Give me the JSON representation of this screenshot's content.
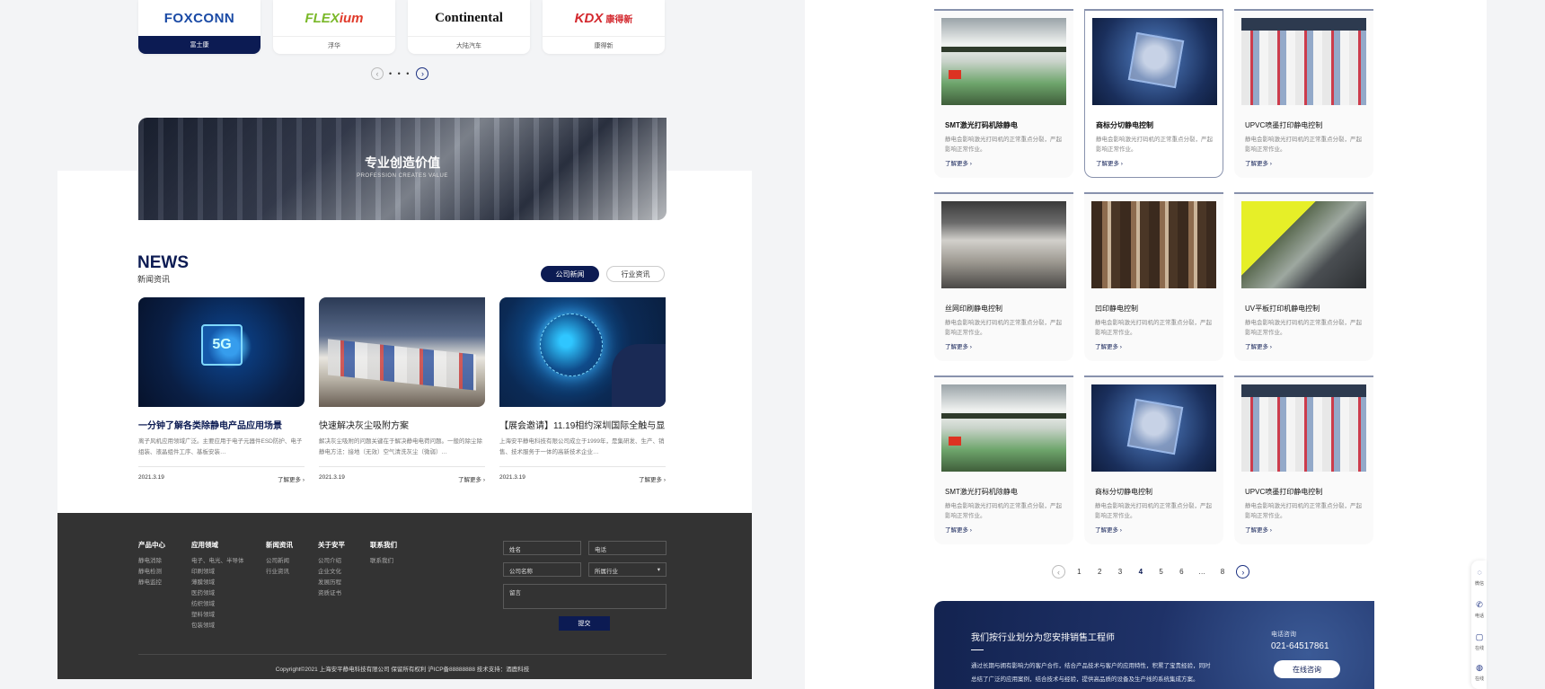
{
  "partners": [
    {
      "logo": "FOXCONN",
      "name": "富士康"
    },
    {
      "logo": "FLEX",
      "logo_accent": "ium",
      "name": "浮华"
    },
    {
      "logo": "Continental",
      "name": "大陆汽车"
    },
    {
      "logo": "KDX",
      "logo_sub": "康得新",
      "name": "康得新"
    }
  ],
  "carousel_dots": "• • •",
  "banner": {
    "title": "专业创造价值",
    "subtitle": "PROFESSION CREATES VALUE"
  },
  "news": {
    "heading": "NEWS",
    "subheading": "新闻资讯",
    "tabs": [
      "公司新闻",
      "行业资讯"
    ],
    "cards": [
      {
        "title": "一分钟了解各类除静电产品应用场景",
        "desc": "离子风机应用领域广泛。主要应用于电子元器件ESD防护、电子组装、液晶组件工序、基板安装…",
        "date": "2021.3.19",
        "more": "了解更多"
      },
      {
        "title": "快速解决灰尘吸附方案",
        "desc": "解决灰尘吸附的问题关键在于解决静电电荷问题。一般的除尘除静电方法：接地（无效）空气清洗灰尘（微弱）…",
        "date": "2021.3.19",
        "more": "了解更多"
      },
      {
        "title": "【展会邀请】11.19相约深圳国际全触与显…",
        "desc": "上海安平静电科技有限公司成立于1999年，是集研发、生产、销售、技术服务于一体的高新技术企业…",
        "date": "2021.3.19",
        "more": "了解更多"
      }
    ]
  },
  "footer": {
    "columns": [
      {
        "title": "产品中心",
        "items": [
          "静电消除",
          "静电检测",
          "静电监控"
        ]
      },
      {
        "title": "应用领域",
        "items": [
          "电子、电光、半导体",
          "印刷领域",
          "薄膜领域",
          "医药领域",
          "纺织领域",
          "塑料领域",
          "包装领域"
        ]
      },
      {
        "title": "新闻资讯",
        "items": [
          "公司新闻",
          "行业资讯"
        ]
      },
      {
        "title": "关于安平",
        "items": [
          "公司介绍",
          "企业文化",
          "发展历程",
          "资质证书"
        ]
      },
      {
        "title": "联系我们",
        "items": [
          "联系我们"
        ]
      }
    ],
    "form": {
      "name": "姓名",
      "phone": "电话",
      "company": "公司名称",
      "industry": "所属行业",
      "message": "留言",
      "submit": "提交"
    },
    "copyright": "Copyright©2021  上海安平静电科技有限公司  保留所有权利  沪ICP备88888888  技术支持：酒鹿科技"
  },
  "products": [
    {
      "title": "SMT激光打码机除静电",
      "desc": "静电会影响激光打码机的正常重点分裂，严起影响正常作业。",
      "more": "了解更多",
      "img": "smt"
    },
    {
      "title": "商标分切静电控制",
      "desc": "静电会影响激光打码机的正常重点分裂，严起影响正常作业。",
      "more": "了解更多",
      "img": "chip"
    },
    {
      "title": "UPVC喷墨打印静电控制",
      "desc": "静电会影响激光打码机的正常重点分裂，严起影响正常作业。",
      "more": "了解更多",
      "img": "upvc"
    },
    {
      "title": "丝网印刷静电控制",
      "desc": "静电会影响激光打码机的正常重点分裂，严起影响正常作业。",
      "more": "了解更多",
      "img": "silk"
    },
    {
      "title": "凹印静电控制",
      "desc": "静电会影响激光打码机的正常重点分裂，严起影响正常作业。",
      "more": "了解更多",
      "img": "ao"
    },
    {
      "title": "UV平板打印机静电控制",
      "desc": "静电会影响激光打码机的正常重点分裂，严起影响正常作业。",
      "more": "了解更多",
      "img": "uv"
    },
    {
      "title": "SMT激光打码机除静电",
      "desc": "静电会影响激光打码机的正常重点分裂，严起影响正常作业。",
      "more": "了解更多",
      "img": "smt"
    },
    {
      "title": "商标分切静电控制",
      "desc": "静电会影响激光打码机的正常重点分裂，严起影响正常作业。",
      "more": "了解更多",
      "img": "chip"
    },
    {
      "title": "UPVC喷墨打印静电控制",
      "desc": "静电会影响激光打码机的正常重点分裂，严起影响正常作业。",
      "more": "了解更多",
      "img": "upvc"
    }
  ],
  "pagination": {
    "pages": [
      "1",
      "2",
      "3",
      "4",
      "5",
      "6",
      "…",
      "8"
    ],
    "current": "4"
  },
  "cta": {
    "title": "我们按行业划分为您安排销售工程师",
    "desc1": "通过长期与拥有影响力的客户合作，结合产品技术与客户的应用特性，积累了宝贵经验，同时",
    "desc2": "总结了广泛的应用案例，结合技术与经验，提供高品质的设备及生产线的系统集成方案。",
    "phone_label": "电话咨询",
    "phone": "021-64517861",
    "button": "在线咨询"
  },
  "side_float": [
    "微信",
    "电话",
    "在线",
    "在线"
  ],
  "colors": {
    "brand": "#0c1b53",
    "footer_bg": "#333333",
    "card_border": "#8892ad"
  }
}
